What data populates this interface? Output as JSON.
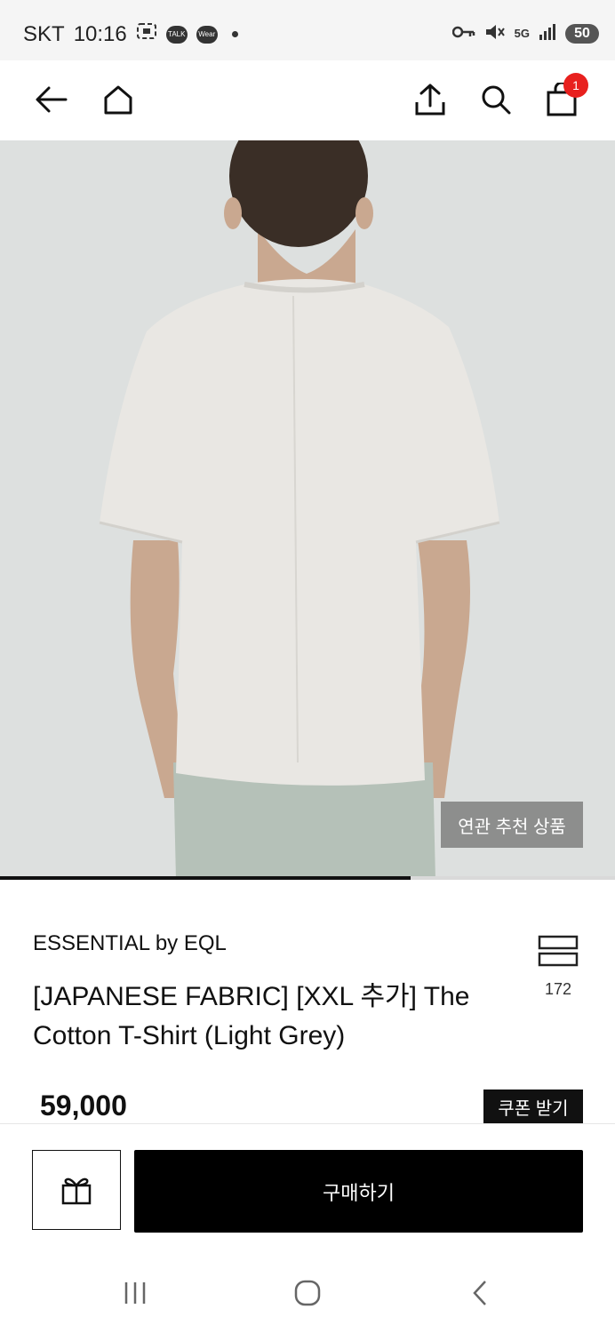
{
  "status_bar": {
    "carrier": "SKT",
    "time": "10:16",
    "notification_icons": [
      "screenshot-icon",
      "kakaotalk-icon",
      "wear-icon"
    ],
    "talk_label": "TALK",
    "wear_label": "Wear",
    "network": "5G",
    "battery": "50"
  },
  "top_nav": {
    "icons": [
      "back-arrow-icon",
      "home-icon",
      "share-icon",
      "search-icon",
      "shopping-bag-icon"
    ],
    "cart_count": "1"
  },
  "hero": {
    "related_products_label": "연관 추천 상품",
    "image_progress": 0.667
  },
  "product": {
    "brand": "ESSENTIAL by EQL",
    "title": "[JAPANESE FABRIC] [XXL 추가] The Cotton T-Shirt (Light Grey)",
    "wish_count": "172",
    "price": "59,000",
    "coupon_label": "쿠폰 받기"
  },
  "bottom_bar": {
    "gift_icon": "gift-icon",
    "buy_label": "구매하기"
  },
  "system_nav": {
    "icons": [
      "recent-apps-icon",
      "home-circle-icon",
      "back-chevron-icon"
    ]
  },
  "colors": {
    "badge": "#e8201e",
    "primary_button": "#000000",
    "hero_background": "#dde0df"
  }
}
